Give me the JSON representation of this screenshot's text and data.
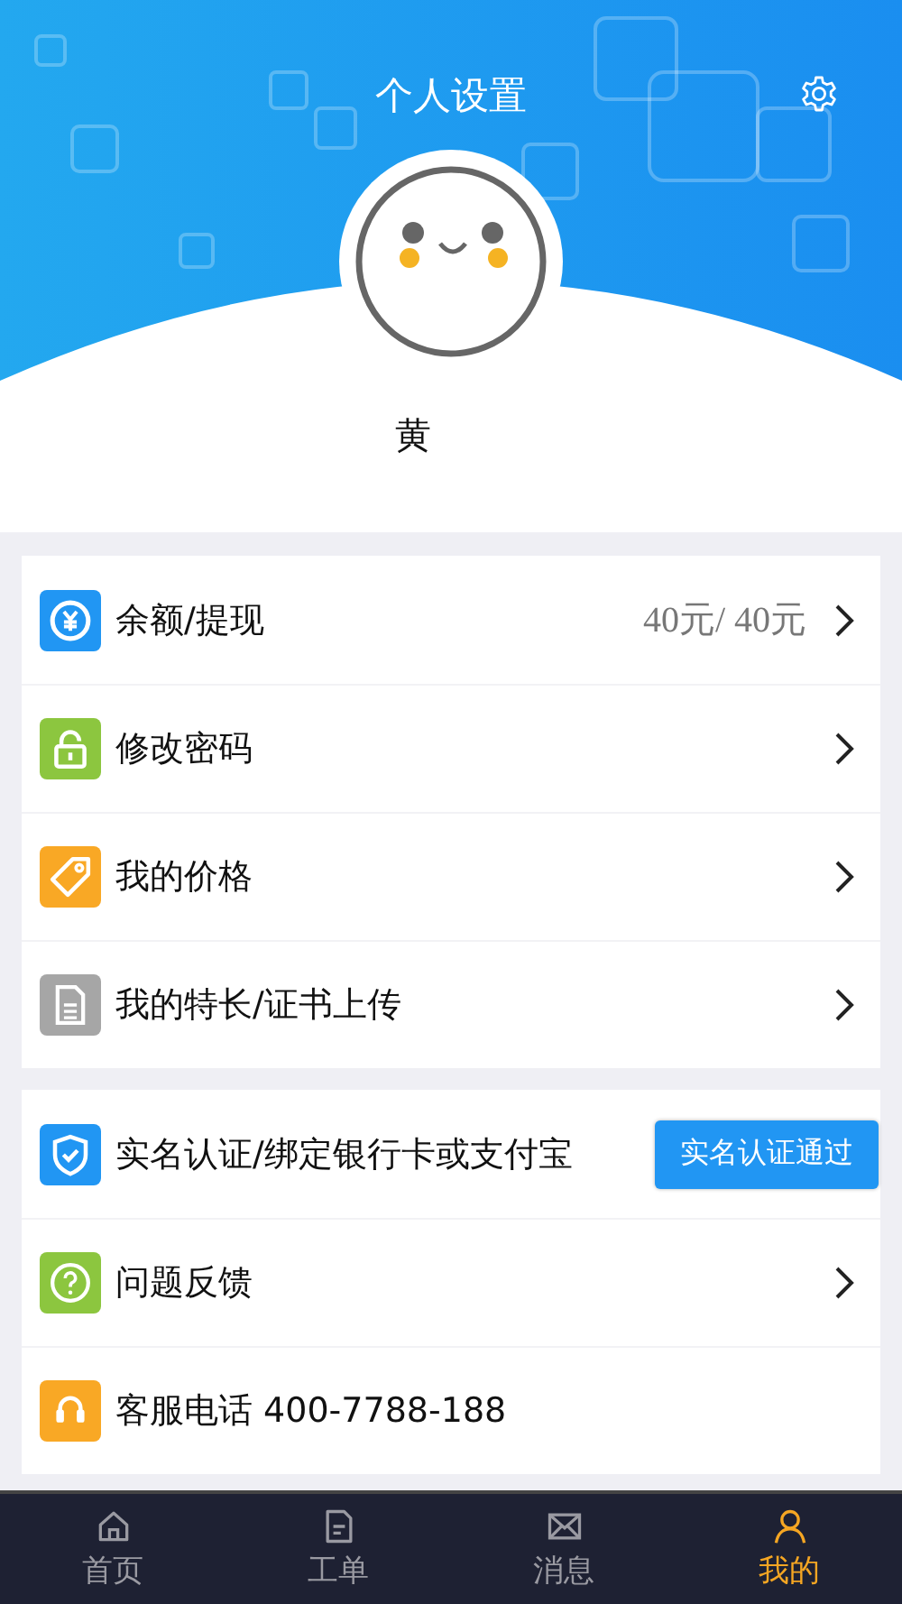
{
  "header": {
    "title": "个人设置"
  },
  "profile": {
    "name": "黄"
  },
  "groups": [
    {
      "items": [
        {
          "kind": "value",
          "label": "余额/提现",
          "value": "40元/ 40元",
          "color": "#2196f3"
        },
        {
          "kind": "link",
          "label": "修改密码",
          "color": "#8cc63f"
        },
        {
          "kind": "link",
          "label": "我的价格",
          "color": "#f9a825"
        },
        {
          "kind": "link",
          "label": "我的特长/证书上传",
          "color": "#a6a6a6"
        }
      ]
    },
    {
      "items": [
        {
          "kind": "button",
          "label": "实名认证/绑定银行卡或支付宝",
          "button": "实名认证通过",
          "color": "#2196f3"
        },
        {
          "kind": "link",
          "label": "问题反馈",
          "color": "#8cc63f"
        },
        {
          "kind": "plain",
          "label": "客服电话 400-7788-188",
          "color": "#f9a825"
        }
      ]
    }
  ],
  "tabs": [
    {
      "label": "首页",
      "selected": false
    },
    {
      "label": "工单",
      "selected": false
    },
    {
      "label": "消息",
      "selected": false
    },
    {
      "label": "我的",
      "selected": true
    }
  ]
}
